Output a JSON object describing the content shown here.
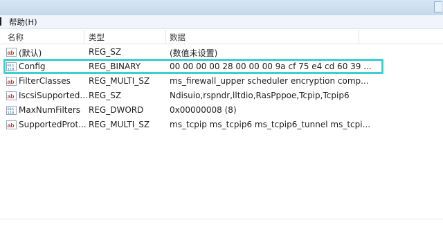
{
  "menu": {
    "help": "帮助(H)"
  },
  "columns": {
    "name": "名称",
    "type": "类型",
    "data": "数据"
  },
  "rows": [
    {
      "name": "(默认)",
      "type": "REG_SZ",
      "data": "(数值未设置)",
      "icon": "string-value-icon"
    },
    {
      "name": "Config",
      "type": "REG_BINARY",
      "data": "00 00 00 00 28 00 00 00 9a cf 75 e4 cd 60 39 ...",
      "icon": "binary-value-icon"
    },
    {
      "name": "FilterClasses",
      "type": "REG_MULTI_SZ",
      "data": "ms_firewall_upper scheduler encryption comp...",
      "icon": "string-value-icon"
    },
    {
      "name": "IscsiSupported...",
      "type": "REG_SZ",
      "data": "Ndisuio,rspndr,lltdio,RasPppoe,Tcpip,Tcpip6",
      "icon": "string-value-icon"
    },
    {
      "name": "MaxNumFilters",
      "type": "REG_DWORD",
      "data": "0x00000008 (8)",
      "icon": "binary-value-icon"
    },
    {
      "name": "SupportedProt...",
      "type": "REG_MULTI_SZ",
      "data": "ms_tcpip ms_tcpip6 ms_tcpip6_tunnel ms_tcpi...",
      "icon": "string-value-icon"
    }
  ],
  "colors": {
    "highlight": "#3cd1d0",
    "string_icon": "#c0392b",
    "binary_icon": "#2a5fb0"
  }
}
